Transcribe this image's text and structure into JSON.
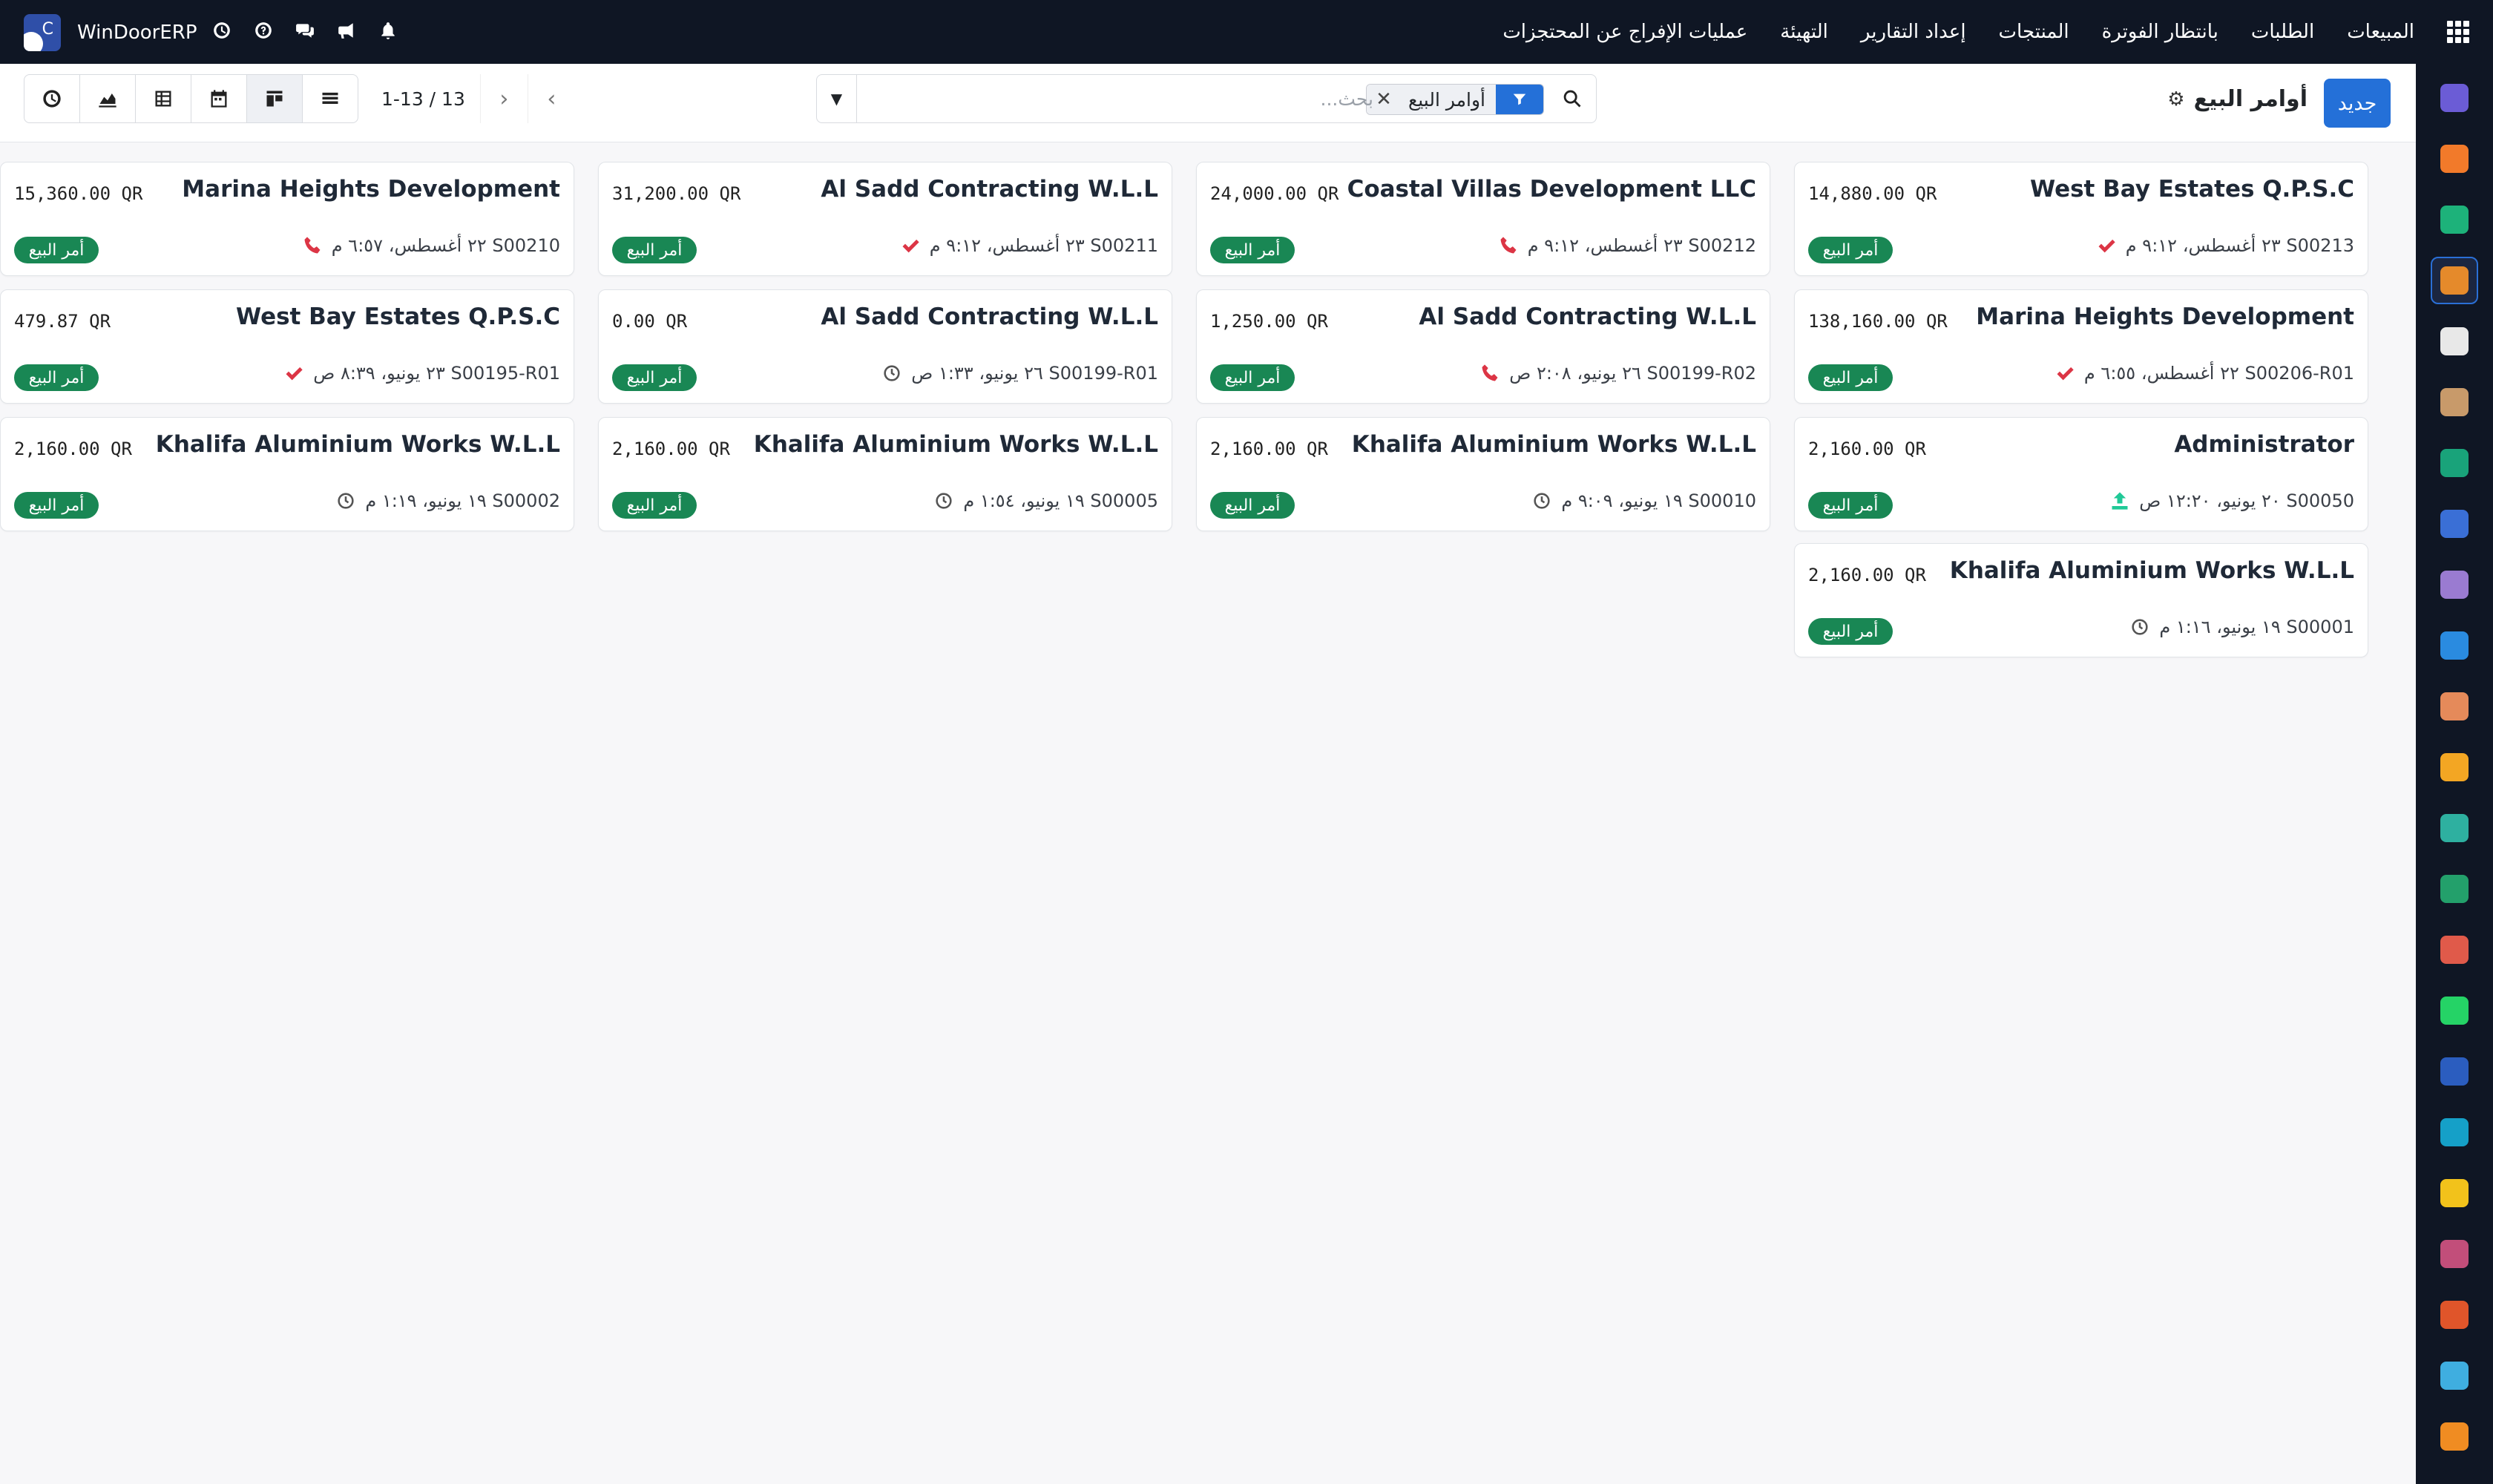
{
  "brand": {
    "name": "WinDoorERP"
  },
  "menu": {
    "items": [
      "المبيعات",
      "الطلبات",
      "بانتظار الفوترة",
      "المنتجات",
      "إعداد التقارير",
      "التهيئة",
      "عمليات الإفراج عن المحتجزات"
    ]
  },
  "control": {
    "new_label": "جديد",
    "title": "أوامر البيع",
    "facet_value": "أوامر البيع",
    "search_placeholder": "بحث...",
    "pager": "1-13 / 13"
  },
  "badge_label": "أمر البيع",
  "cards": [
    {
      "partner": "West Bay Estates Q.P.S.C",
      "amount": "14,880.00 QR",
      "ref": "S00213 ٢٣ أغسطس، ٩:١٢ م",
      "activity": "check"
    },
    {
      "partner": "Coastal Villas Development LLC",
      "amount": "24,000.00 QR",
      "ref": "S00212 ٢٣ أغسطس، ٩:١٢ م",
      "activity": "phone"
    },
    {
      "partner": "Al Sadd Contracting W.L.L",
      "amount": "31,200.00 QR",
      "ref": "S00211 ٢٣ أغسطس، ٩:١٢ م",
      "activity": "check"
    },
    {
      "partner": "Marina Heights Development",
      "amount": "15,360.00 QR",
      "ref": "S00210 ٢٢ أغسطس، ٦:٥٧ م",
      "activity": "phone"
    },
    {
      "partner": "Marina Heights Development",
      "amount": "138,160.00 QR",
      "ref": "S00206-R01 ٢٢ أغسطس، ٦:٥٥ م",
      "activity": "check"
    },
    {
      "partner": "Al Sadd Contracting W.L.L",
      "amount": "1,250.00 QR",
      "ref": "S00199-R02 ٢٦ يونيو، ٢:٠٨ ص",
      "activity": "phone"
    },
    {
      "partner": "Al Sadd Contracting W.L.L",
      "amount": "0.00 QR",
      "ref": "S00199-R01 ٢٦ يونيو، ١:٣٣ ص",
      "activity": "clock"
    },
    {
      "partner": "West Bay Estates Q.P.S.C",
      "amount": "479.87 QR",
      "ref": "S00195-R01 ٢٣ يونيو، ٨:٣٩ ص",
      "activity": "check"
    },
    {
      "partner": "Administrator",
      "amount": "2,160.00 QR",
      "ref": "S00050 ٢٠ يونيو، ١٢:٢٠ ص",
      "activity": "upload"
    },
    {
      "partner": "Khalifa Aluminium Works W.L.L",
      "amount": "2,160.00 QR",
      "ref": "S00010 ١٩ يونيو، ٩:٠٩ م",
      "activity": "clock"
    },
    {
      "partner": "Khalifa Aluminium Works W.L.L",
      "amount": "2,160.00 QR",
      "ref": "S00005 ١٩ يونيو، ١:٥٤ م",
      "activity": "clock"
    },
    {
      "partner": "Khalifa Aluminium Works W.L.L",
      "amount": "2,160.00 QR",
      "ref": "S00002 ١٩ يونيو، ١:١٩ م",
      "activity": "clock"
    },
    {
      "partner": "Khalifa Aluminium Works W.L.L",
      "amount": "2,160.00 QR",
      "ref": "S00001 ١٩ يونيو، ١:١٦ م",
      "activity": "clock"
    }
  ],
  "colors": {
    "navbar": "#0f1624",
    "primary": "#2470d8",
    "badge": "#198754",
    "danger": "#dc3545",
    "success": "#20c997"
  },
  "dock_icons": [
    {
      "name": "email-marketing-icon",
      "color": "#6b5cd6"
    },
    {
      "name": "discuss-icon",
      "color": "#f27a2a"
    },
    {
      "name": "sign-icon",
      "color": "#1db27a"
    },
    {
      "name": "sales-icon",
      "color": "#e58a2b"
    },
    {
      "name": "inventory-icon",
      "color": "#e8e8e8"
    },
    {
      "name": "employees-icon",
      "color": "#c89a6a"
    },
    {
      "name": "project-icon",
      "color": "#19a37a"
    },
    {
      "name": "knowledge-icon",
      "color": "#3a6fd6"
    },
    {
      "name": "barcode-icon",
      "color": "#9a7bd1"
    },
    {
      "name": "invoicing-icon",
      "color": "#2a8be0"
    },
    {
      "name": "contacts-icon",
      "color": "#e58a5a"
    },
    {
      "name": "calendar-icon",
      "color": "#f3a623"
    },
    {
      "name": "studio-icon",
      "color": "#2eb0a0"
    },
    {
      "name": "hr-icon",
      "color": "#23a06b"
    },
    {
      "name": "dashboards-icon",
      "color": "#e05a4a"
    },
    {
      "name": "whatsapp-icon",
      "color": "#25d366"
    },
    {
      "name": "website-icon",
      "color": "#2b5dbf"
    },
    {
      "name": "helpdesk-icon",
      "color": "#15a0c8"
    },
    {
      "name": "telegram-icon",
      "color": "#f2c21b"
    },
    {
      "name": "apps-icon",
      "color": "#c24e7a"
    },
    {
      "name": "module-icon",
      "color": "#e0552a"
    },
    {
      "name": "pie-icon",
      "color": "#3faee0"
    },
    {
      "name": "odoo-icon",
      "color": "#f08c22"
    }
  ]
}
